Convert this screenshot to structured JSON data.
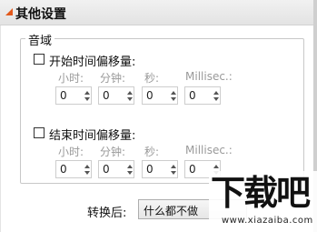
{
  "section_title": "其他设置",
  "group": {
    "label": "音域"
  },
  "start_offset": {
    "label": "开始时间偏移量:",
    "checked": false,
    "columns": [
      "小时:",
      "分钟:",
      "秒:",
      "Millisec.:"
    ],
    "values": [
      "0",
      "0",
      "0",
      "0"
    ]
  },
  "end_offset": {
    "label": "结束时间偏移量:",
    "checked": false,
    "columns": [
      "小时:",
      "分钟:",
      "秒:",
      "Millisec.:"
    ],
    "values": [
      "0",
      "0",
      "0",
      "0"
    ]
  },
  "convert": {
    "label": "转换后:",
    "selected": "什么都不做"
  },
  "watermark": {
    "logo_text": "下载吧",
    "url": "www.xiazaiba.com"
  },
  "colors": {
    "accent_triangle": "#e2581b",
    "header_bg": "#e8e8e8"
  }
}
